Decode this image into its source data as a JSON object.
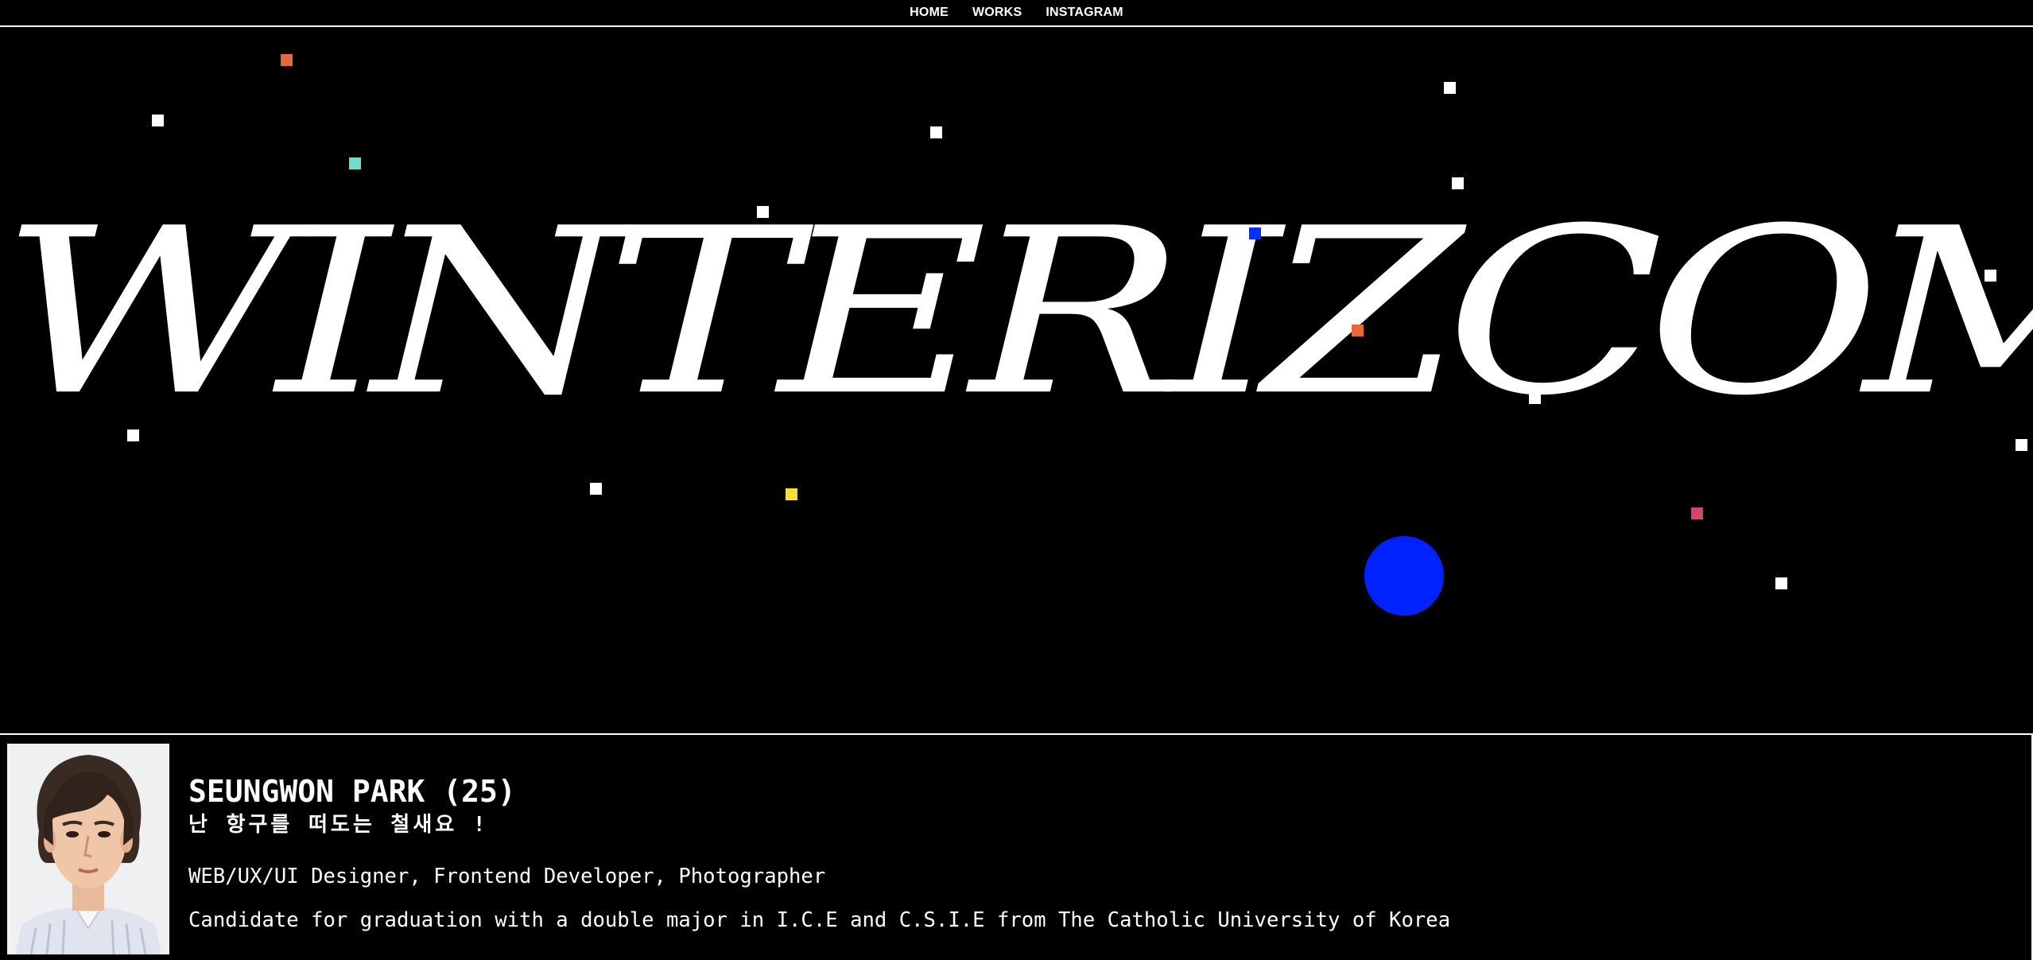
{
  "nav": {
    "items": [
      {
        "label": "HOME"
      },
      {
        "label": "WORKS"
      },
      {
        "label": "INSTAGRAM"
      }
    ]
  },
  "hero": {
    "title": "WINTERIZCOMING_"
  },
  "colors": {
    "background": "#000000",
    "text": "#ffffff",
    "orb": "#0022ff",
    "particle_white": "#ffffff",
    "particle_orange": "#e8673f",
    "particle_teal": "#6ee0c8",
    "particle_blue": "#0a2cff",
    "particle_yellow": "#f5dd3a",
    "particle_pink": "#d4476a"
  },
  "profile": {
    "name": "SEUNGWON PARK (25)",
    "tagline": "난 항구를 떠도는 철새요 !",
    "roles": "WEB/UX/UI Designer, Frontend Developer, Photographer",
    "education": "Candidate for graduation with a double major in I.C.E and C.S.I.E from The Catholic University of Korea"
  }
}
